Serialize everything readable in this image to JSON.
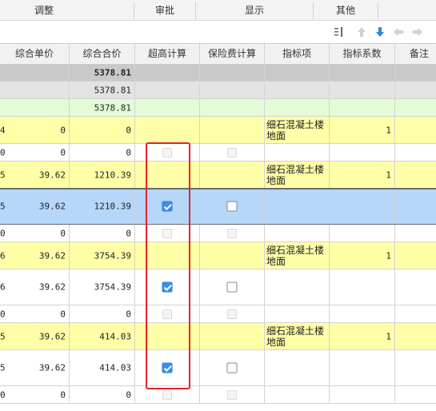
{
  "tabs": [
    "调整",
    "审批",
    "显示",
    "其他"
  ],
  "toolbar": {
    "icons": [
      "column-settings-icon",
      "move-up-icon",
      "move-down-icon",
      "move-left-icon",
      "move-right-icon"
    ]
  },
  "columns": [
    "综合单价",
    "综合合价",
    "超高计算",
    "保险费计算",
    "指标项",
    "指标系数",
    "备注"
  ],
  "rows": [
    {
      "type": "total",
      "idx": "",
      "price": "",
      "total": "5378.81"
    },
    {
      "type": "sub",
      "idx": "",
      "price": "",
      "total": "5378.81"
    },
    {
      "type": "sub2",
      "idx": "",
      "price": "",
      "total": "5378.81"
    },
    {
      "type": "item",
      "idx": "4",
      "price": "0",
      "total": "0",
      "cb1": "none",
      "cb2": "none",
      "indicator": "细石混凝土楼地面",
      "coef": "1"
    },
    {
      "type": "white",
      "idx": "0",
      "price": "0",
      "total": "0",
      "cb1": "off",
      "cb2": "off"
    },
    {
      "type": "item",
      "idx": "5",
      "price": "39.62",
      "total": "1210.39",
      "cb1": "none",
      "cb2": "none",
      "indicator": "细石混凝土楼地面",
      "coef": "1"
    },
    {
      "type": "selected",
      "idx": "5",
      "price": "39.62",
      "total": "1210.39",
      "cb1": "on",
      "cb2": "empty"
    },
    {
      "type": "white",
      "idx": "0",
      "price": "0",
      "total": "0",
      "cb1": "off",
      "cb2": "off"
    },
    {
      "type": "item",
      "idx": "6",
      "price": "39.62",
      "total": "3754.39",
      "cb1": "none",
      "cb2": "none",
      "indicator": "细石混凝土楼地面",
      "coef": "1"
    },
    {
      "type": "white-tall",
      "idx": "6",
      "price": "39.62",
      "total": "3754.39",
      "cb1": "on",
      "cb2": "empty"
    },
    {
      "type": "white",
      "idx": "0",
      "price": "0",
      "total": "0",
      "cb1": "off",
      "cb2": "off"
    },
    {
      "type": "item",
      "idx": "5",
      "price": "39.62",
      "total": "414.03",
      "cb1": "none",
      "cb2": "none",
      "indicator": "细石混凝土楼地面",
      "coef": "1"
    },
    {
      "type": "white-tall",
      "idx": "5",
      "price": "39.62",
      "total": "414.03",
      "cb1": "on",
      "cb2": "empty"
    },
    {
      "type": "white",
      "idx": "0",
      "price": "0",
      "total": "0",
      "cb1": "off",
      "cb2": "off"
    }
  ],
  "colors": {
    "yellow": "#ffffa8",
    "green": "#e4fcd6",
    "grey": "#c9c9c9",
    "grey2": "#e3e3e3",
    "selected": "#b6d6fa",
    "accent": "#3b8ee8",
    "highlight": "#e5232a"
  }
}
